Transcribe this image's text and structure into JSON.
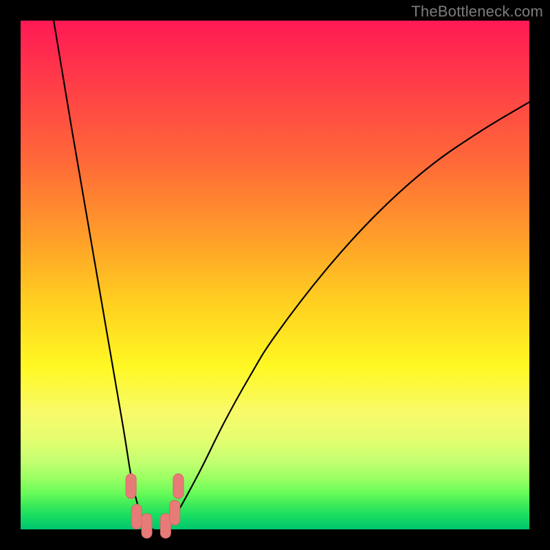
{
  "watermark": "TheBottleneck.com",
  "colors": {
    "bg": "#000000",
    "curve": "#000000",
    "marker_fill": "#e77b77",
    "marker_stroke": "#d46a66"
  },
  "chart_data": {
    "type": "line",
    "title": "",
    "xlabel": "",
    "ylabel": "",
    "xlim": [
      0,
      100
    ],
    "ylim": [
      0,
      100
    ],
    "grid": false,
    "legend": false,
    "series": [
      {
        "name": "bottleneck-curve",
        "x": [
          6.5,
          10,
          15,
          20,
          22,
          24,
          26,
          28,
          30,
          35,
          40,
          45,
          50,
          60,
          70,
          80,
          90,
          100
        ],
        "values": [
          100,
          79,
          50,
          21,
          9,
          2,
          0,
          0,
          2,
          11,
          21,
          30,
          38,
          51,
          62,
          71,
          78,
          84
        ]
      }
    ],
    "markers": [
      {
        "x": 21.7,
        "y": 8.5
      },
      {
        "x": 22.8,
        "y": 2.5
      },
      {
        "x": 24.8,
        "y": 0.7
      },
      {
        "x": 28.5,
        "y": 0.7
      },
      {
        "x": 30.3,
        "y": 3.3
      },
      {
        "x": 31.0,
        "y": 8.5
      }
    ],
    "gradient_stops": [
      {
        "pos": 0,
        "color": "#ff1955"
      },
      {
        "pos": 12,
        "color": "#ff3c48"
      },
      {
        "pos": 28,
        "color": "#ff6a38"
      },
      {
        "pos": 42,
        "color": "#ff9c2a"
      },
      {
        "pos": 55,
        "color": "#ffce20"
      },
      {
        "pos": 68,
        "color": "#fff823"
      },
      {
        "pos": 77,
        "color": "#f8fa6a"
      },
      {
        "pos": 82,
        "color": "#e6fd6f"
      },
      {
        "pos": 87,
        "color": "#c0ff70"
      },
      {
        "pos": 90,
        "color": "#99ff62"
      },
      {
        "pos": 93,
        "color": "#66fa59"
      },
      {
        "pos": 95,
        "color": "#40ec58"
      },
      {
        "pos": 97,
        "color": "#1cdf5f"
      },
      {
        "pos": 100,
        "color": "#00c66f"
      }
    ]
  }
}
